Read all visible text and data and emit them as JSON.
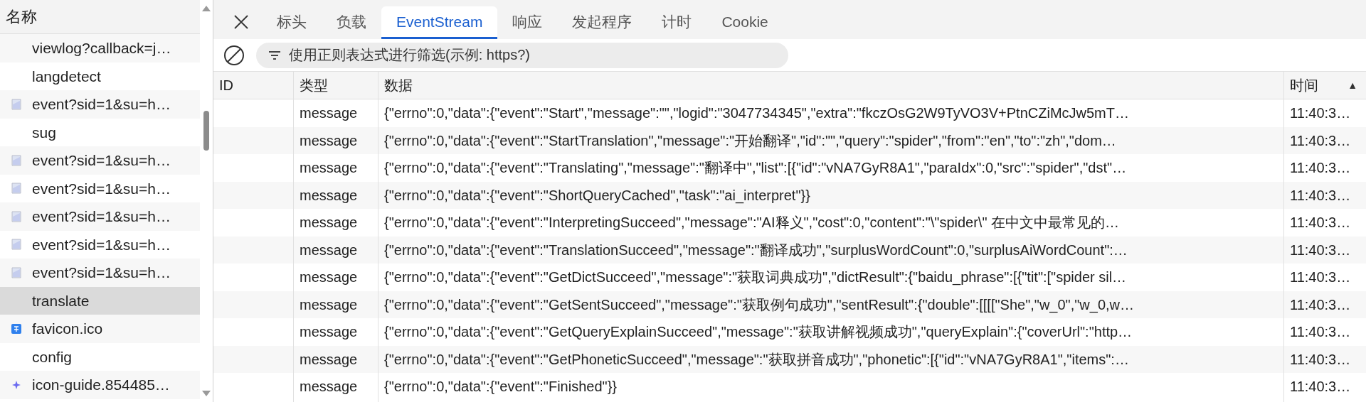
{
  "sidebar": {
    "header": "名称",
    "items": [
      {
        "label": "viewlog?callback=j…",
        "kind": "plain",
        "selected": false
      },
      {
        "label": "langdetect",
        "kind": "plain",
        "selected": false
      },
      {
        "label": "event?sid=1&su=h…",
        "kind": "document",
        "selected": false
      },
      {
        "label": "sug",
        "kind": "plain",
        "selected": false
      },
      {
        "label": "event?sid=1&su=h…",
        "kind": "document",
        "selected": false
      },
      {
        "label": "event?sid=1&su=h…",
        "kind": "document",
        "selected": false
      },
      {
        "label": "event?sid=1&su=h…",
        "kind": "document",
        "selected": false
      },
      {
        "label": "event?sid=1&su=h…",
        "kind": "document",
        "selected": false
      },
      {
        "label": "event?sid=1&su=h…",
        "kind": "document",
        "selected": false
      },
      {
        "label": "translate",
        "kind": "plain",
        "selected": true
      },
      {
        "label": "favicon.ico",
        "kind": "favicon",
        "selected": false
      },
      {
        "label": "config",
        "kind": "plain",
        "selected": false
      },
      {
        "label": "icon-guide.854485…",
        "kind": "sparkle",
        "selected": false
      }
    ]
  },
  "tabs": [
    {
      "label": "标头",
      "selected": false
    },
    {
      "label": "负载",
      "selected": false
    },
    {
      "label": "EventStream",
      "selected": true
    },
    {
      "label": "响应",
      "selected": false
    },
    {
      "label": "发起程序",
      "selected": false
    },
    {
      "label": "计时",
      "selected": false
    },
    {
      "label": "Cookie",
      "selected": false
    }
  ],
  "filter": {
    "placeholder": "使用正则表达式进行筛选(示例: https?)"
  },
  "table": {
    "columns": [
      "ID",
      "类型",
      "数据",
      "时间"
    ],
    "sort_indicator": "▲",
    "rows": [
      [
        "",
        "message",
        "{\"errno\":0,\"data\":{\"event\":\"Start\",\"message\":\"\",\"logid\":\"3047734345\",\"extra\":\"fkczOsG2W9TyVO3V+PtnCZiMcJw5mT…",
        "11:40:3…"
      ],
      [
        "",
        "message",
        "{\"errno\":0,\"data\":{\"event\":\"StartTranslation\",\"message\":\"开始翻译\",\"id\":\"\",\"query\":\"spider\",\"from\":\"en\",\"to\":\"zh\",\"dom…",
        "11:40:3…"
      ],
      [
        "",
        "message",
        "{\"errno\":0,\"data\":{\"event\":\"Translating\",\"message\":\"翻译中\",\"list\":[{\"id\":\"vNA7GyR8A1\",\"paraIdx\":0,\"src\":\"spider\",\"dst\"…",
        "11:40:3…"
      ],
      [
        "",
        "message",
        "{\"errno\":0,\"data\":{\"event\":\"ShortQueryCached\",\"task\":\"ai_interpret\"}}",
        "11:40:3…"
      ],
      [
        "",
        "message",
        "{\"errno\":0,\"data\":{\"event\":\"InterpretingSucceed\",\"message\":\"AI释义\",\"cost\":0,\"content\":\"\\\"spider\\\" 在中文中最常见的…",
        "11:40:3…"
      ],
      [
        "",
        "message",
        "{\"errno\":0,\"data\":{\"event\":\"TranslationSucceed\",\"message\":\"翻译成功\",\"surplusWordCount\":0,\"surplusAiWordCount\":…",
        "11:40:3…"
      ],
      [
        "",
        "message",
        "{\"errno\":0,\"data\":{\"event\":\"GetDictSucceed\",\"message\":\"获取词典成功\",\"dictResult\":{\"baidu_phrase\":[{\"tit\":[\"spider sil…",
        "11:40:3…"
      ],
      [
        "",
        "message",
        "{\"errno\":0,\"data\":{\"event\":\"GetSentSucceed\",\"message\":\"获取例句成功\",\"sentResult\":{\"double\":[[[[\"She\",\"w_0\",\"w_0,w…",
        "11:40:3…"
      ],
      [
        "",
        "message",
        "{\"errno\":0,\"data\":{\"event\":\"GetQueryExplainSucceed\",\"message\":\"获取讲解视频成功\",\"queryExplain\":{\"coverUrl\":\"http…",
        "11:40:3…"
      ],
      [
        "",
        "message",
        "{\"errno\":0,\"data\":{\"event\":\"GetPhoneticSucceed\",\"message\":\"获取拼音成功\",\"phonetic\":[{\"id\":\"vNA7GyR8A1\",\"items\":…",
        "11:40:3…"
      ],
      [
        "",
        "message",
        "{\"errno\":0,\"data\":{\"event\":\"Finished\"}}",
        "11:40:3…"
      ]
    ]
  }
}
